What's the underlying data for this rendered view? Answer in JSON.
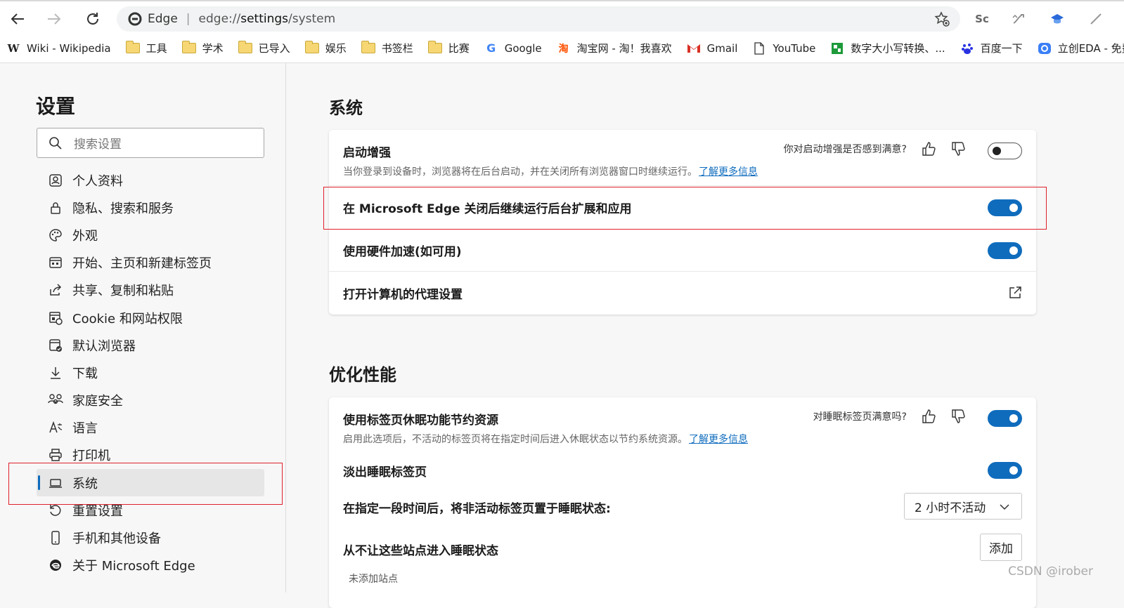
{
  "browser": {
    "address": {
      "app_label": "Edge",
      "separator": "|",
      "url_scheme": "edge://",
      "url_host": "settings",
      "url_path": "/system"
    },
    "extensions": [
      "Sc"
    ]
  },
  "bookmarks": [
    {
      "label": "Wiki - Wikipedia",
      "icon": "wikipedia-icon"
    },
    {
      "label": "工具",
      "icon": "folder-icon"
    },
    {
      "label": "学术",
      "icon": "folder-icon"
    },
    {
      "label": "已导入",
      "icon": "folder-icon"
    },
    {
      "label": "娱乐",
      "icon": "folder-icon"
    },
    {
      "label": "书签栏",
      "icon": "folder-icon"
    },
    {
      "label": "比赛",
      "icon": "folder-icon"
    },
    {
      "label": "Google",
      "icon": "google-icon"
    },
    {
      "label": "淘宝网 - 淘！我喜欢",
      "icon": "taobao-icon"
    },
    {
      "label": "Gmail",
      "icon": "gmail-icon"
    },
    {
      "label": "YouTube",
      "icon": "page-icon"
    },
    {
      "label": "数字大小写转换、...",
      "icon": "green-app-icon"
    },
    {
      "label": "百度一下",
      "icon": "baidu-icon"
    },
    {
      "label": "立创EDA - 免费、...",
      "icon": "lceda-icon"
    }
  ],
  "sidebar": {
    "title": "设置",
    "search_placeholder": "搜索设置",
    "items": [
      {
        "label": "个人资料",
        "icon": "profile-icon"
      },
      {
        "label": "隐私、搜索和服务",
        "icon": "lock-icon"
      },
      {
        "label": "外观",
        "icon": "palette-icon"
      },
      {
        "label": "开始、主页和新建标签页",
        "icon": "home-tabs-icon"
      },
      {
        "label": "共享、复制和粘贴",
        "icon": "share-icon"
      },
      {
        "label": "Cookie 和网站权限",
        "icon": "cookie-icon"
      },
      {
        "label": "默认浏览器",
        "icon": "default-browser-icon"
      },
      {
        "label": "下载",
        "icon": "download-icon"
      },
      {
        "label": "家庭安全",
        "icon": "family-icon"
      },
      {
        "label": "语言",
        "icon": "language-icon"
      },
      {
        "label": "打印机",
        "icon": "printer-icon"
      },
      {
        "label": "系统",
        "icon": "laptop-icon",
        "active": true
      },
      {
        "label": "重置设置",
        "icon": "reset-icon"
      },
      {
        "label": "手机和其他设备",
        "icon": "phone-icon"
      },
      {
        "label": "关于 Microsoft Edge",
        "icon": "edge-icon"
      }
    ]
  },
  "system": {
    "title": "系统",
    "startup_boost": {
      "title": "启动增强",
      "desc": "当你登录到设备时，浏览器将在后台启动，并在关闭所有浏览器窗口时继续运行。",
      "link": "了解更多信息",
      "feedback": "你对启动增强是否感到满意?",
      "enabled": false
    },
    "background_apps": {
      "title": "在 Microsoft Edge 关闭后继续运行后台扩展和应用",
      "enabled": true
    },
    "hardware_accel": {
      "title": "使用硬件加速(如可用)",
      "enabled": true
    },
    "proxy": {
      "title": "打开计算机的代理设置"
    }
  },
  "performance": {
    "title": "优化性能",
    "sleeping_tabs": {
      "title": "使用标签页休眠功能节约资源",
      "desc": "启用此选项后，不活动的标签页将在指定时间后进入休眠状态以节约系统资源。",
      "link": "了解更多信息",
      "feedback": "对睡眠标签页满意吗?",
      "enabled": true
    },
    "fade_tabs": {
      "title": "淡出睡眠标签页",
      "enabled": true
    },
    "sleep_after": {
      "title": "在指定一段时间后，将非活动标签页置于睡眠状态:",
      "value": "2 小时不活动"
    },
    "never_sleep": {
      "title": "从不让这些站点进入睡眠状态",
      "button": "添加",
      "empty": "未添加站点"
    }
  },
  "watermark": "CSDN @irober",
  "colors": {
    "accent": "#0f6cbd",
    "highlight_box": "#e0202a"
  }
}
